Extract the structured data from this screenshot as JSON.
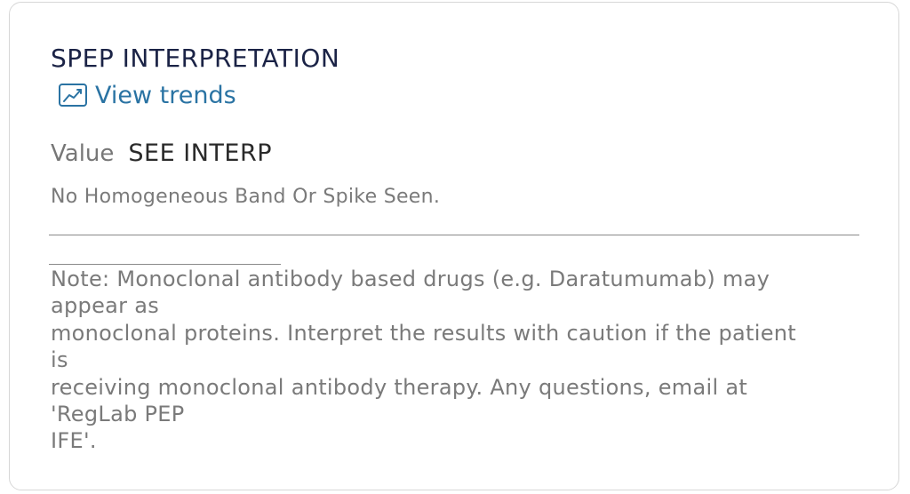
{
  "card": {
    "title": "SPEP INTERPRETATION",
    "trends_link": {
      "icon": "trend-chart-icon",
      "label": "View trends"
    },
    "value": {
      "label": "Value",
      "text": "SEE INTERP"
    },
    "result": "No Homogeneous Band Or Spike Seen.",
    "note_lines": [
      "Note: Monoclonal antibody based drugs (e.g. Daratumumab) may",
      "appear as",
      "monoclonal proteins. Interpret the results with caution if the patient",
      "is",
      "receiving monoclonal antibody therapy. Any questions, email at",
      "'RegLab PEP",
      "IFE'."
    ]
  },
  "colors": {
    "title": "#1b2346",
    "link": "#2a73a3",
    "muted_text": "#7a7a7a",
    "value_text": "#2a2a2a",
    "border": "#d7d7d7"
  }
}
